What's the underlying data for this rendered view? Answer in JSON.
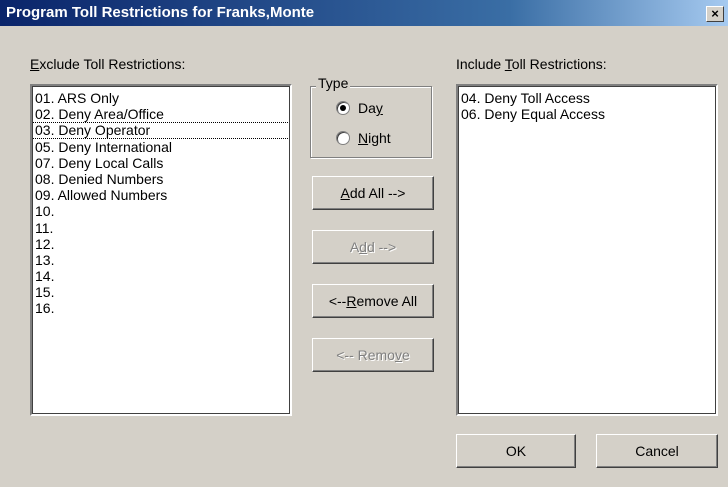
{
  "window": {
    "title": "Program Toll Restrictions for Franks,Monte",
    "close_label": "×"
  },
  "exclude": {
    "label_accel": "E",
    "label_rest": "xclude Toll Restrictions:",
    "items": [
      "01. ARS Only",
      "02. Deny Area/Office",
      "03. Deny Operator",
      "05. Deny International",
      "07. Deny Local Calls",
      "08. Denied Numbers",
      "09. Allowed Numbers",
      "10.",
      "11.",
      "12.",
      "13.",
      "14.",
      "15.",
      "16."
    ],
    "focused_index": 2
  },
  "include": {
    "label_pre": "Include ",
    "label_accel": "T",
    "label_rest": "oll Restrictions:",
    "items": [
      "04. Deny Toll Access",
      "06. Deny Equal Access"
    ]
  },
  "type": {
    "legend": "Type",
    "day_pre": "Da",
    "day_accel": "y",
    "day_post": "",
    "night_pre": "",
    "night_accel": "N",
    "night_post": "ight",
    "selected": "Day"
  },
  "buttons": {
    "add_all_accel": "A",
    "add_all_rest": "dd All -->",
    "add_pre": "A",
    "add_accel": "d",
    "add_rest": "d -->",
    "remove_all_pre": "<-- ",
    "remove_all_accel": "R",
    "remove_all_rest": "emove All",
    "remove_pre": "<-- Remo",
    "remove_accel": "v",
    "remove_rest": "e",
    "ok": "OK",
    "cancel": "Cancel"
  }
}
